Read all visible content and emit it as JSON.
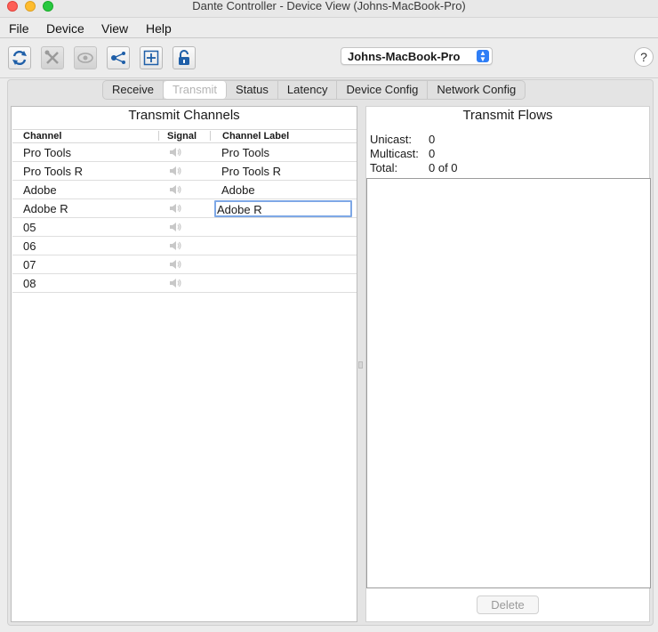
{
  "window": {
    "title": "Dante Controller - Device View (Johns-MacBook-Pro)"
  },
  "menu": {
    "items": [
      "File",
      "Device",
      "View",
      "Help"
    ]
  },
  "toolbar": {
    "buttons": [
      {
        "name": "refresh-icon",
        "enabled": true
      },
      {
        "name": "tools-icon",
        "enabled": false
      },
      {
        "name": "eye-icon",
        "enabled": false
      },
      {
        "name": "network-icon",
        "enabled": true
      },
      {
        "name": "plus-icon",
        "enabled": true
      },
      {
        "name": "lock-icon",
        "enabled": true
      }
    ],
    "device_selected": "Johns-MacBook-Pro",
    "help_label": "?"
  },
  "tabs": [
    {
      "label": "Receive",
      "active": false
    },
    {
      "label": "Transmit",
      "active": true
    },
    {
      "label": "Status",
      "active": false
    },
    {
      "label": "Latency",
      "active": false
    },
    {
      "label": "Device Config",
      "active": false
    },
    {
      "label": "Network Config",
      "active": false
    }
  ],
  "transmit_channels": {
    "title": "Transmit Channels",
    "headers": {
      "channel": "Channel",
      "signal": "Signal",
      "label": "Channel Label"
    },
    "rows": [
      {
        "channel": "Pro Tools",
        "label": "Pro Tools"
      },
      {
        "channel": "Pro Tools R",
        "label": "Pro Tools R"
      },
      {
        "channel": "Adobe",
        "label": "Adobe"
      },
      {
        "channel": "Adobe R",
        "label": "Adobe R",
        "editing": true
      },
      {
        "channel": "05",
        "label": ""
      },
      {
        "channel": "06",
        "label": ""
      },
      {
        "channel": "07",
        "label": ""
      },
      {
        "channel": "08",
        "label": ""
      }
    ]
  },
  "transmit_flows": {
    "title": "Transmit Flows",
    "unicast_label": "Unicast:",
    "unicast_value": "0",
    "multicast_label": "Multicast:",
    "multicast_value": "0",
    "total_label": "Total:",
    "total_value": "0 of 0",
    "delete_label": "Delete"
  }
}
